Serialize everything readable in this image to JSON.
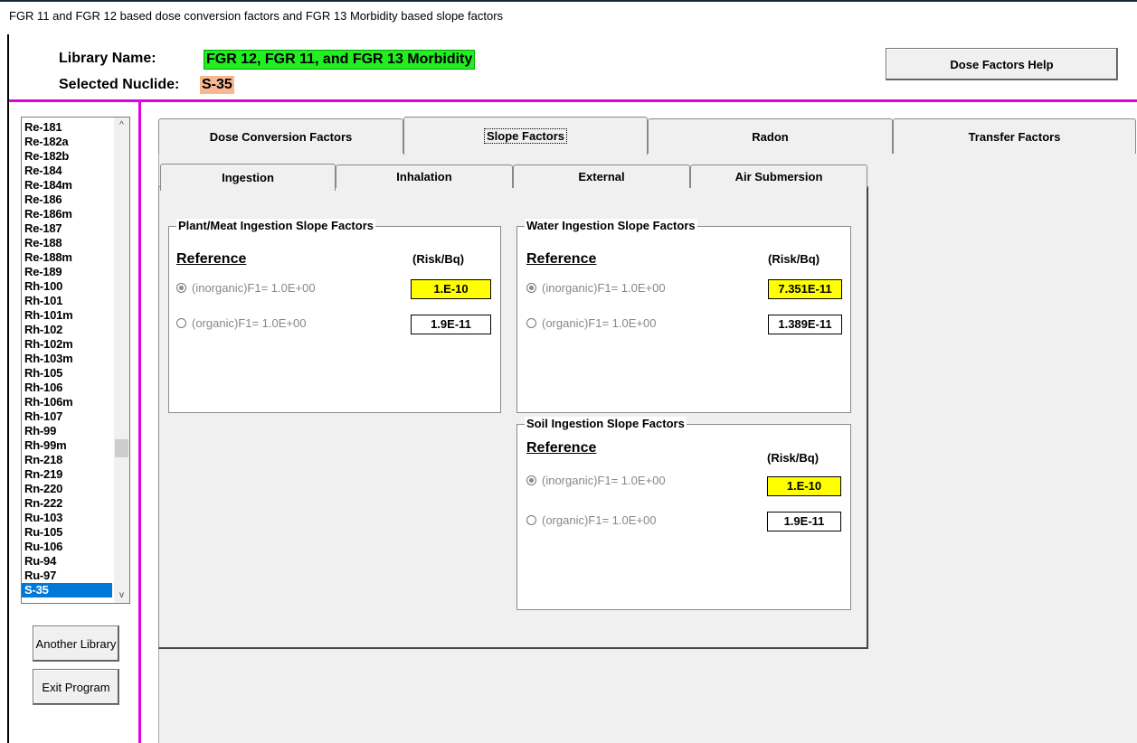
{
  "window": {
    "title": "FGR 11 and FGR 12 based dose conversion factors and FGR 13 Morbidity based slope factors"
  },
  "header": {
    "library_label": "Library Name:",
    "library_value": "FGR 12, FGR 11, and FGR 13 Morbidity",
    "nuclide_label": "Selected Nuclide:",
    "nuclide_value": "S-35",
    "help_button": "Dose Factors Help"
  },
  "nuclide_list": {
    "items": [
      "Re-181",
      "Re-182a",
      "Re-182b",
      "Re-184",
      "Re-184m",
      "Re-186",
      "Re-186m",
      "Re-187",
      "Re-188",
      "Re-188m",
      "Re-189",
      "Rh-100",
      "Rh-101",
      "Rh-101m",
      "Rh-102",
      "Rh-102m",
      "Rh-103m",
      "Rh-105",
      "Rh-106",
      "Rh-106m",
      "Rh-107",
      "Rh-99",
      "Rh-99m",
      "Rn-218",
      "Rn-219",
      "Rn-220",
      "Rn-222",
      "Ru-103",
      "Ru-105",
      "Ru-106",
      "Ru-94",
      "Ru-97",
      "S-35"
    ],
    "selected": "S-35",
    "scroll_up": "^",
    "scroll_down": "v"
  },
  "side_buttons": {
    "another_library": "Another Library",
    "exit_program": "Exit Program"
  },
  "main_tabs": {
    "dose": "Dose Conversion Factors",
    "slope": "Slope Factors",
    "radon": "Radon",
    "transfer": "Transfer Factors",
    "active": "slope"
  },
  "sub_tabs": {
    "ingestion": "Ingestion",
    "inhalation": "Inhalation",
    "external": "External",
    "air": "Air Submersion",
    "active": "ingestion"
  },
  "plant_meat": {
    "title": "Plant/Meat Ingestion Slope Factors",
    "reference": "Reference",
    "unit": "(Risk/Bq)",
    "inorganic_label": "(inorganic)F1= 1.0E+00",
    "inorganic_value": "1.E-10",
    "organic_label": "(organic)F1= 1.0E+00",
    "organic_value": "1.9E-11"
  },
  "water": {
    "title": "Water Ingestion Slope Factors",
    "reference": "Reference",
    "unit": "(Risk/Bq)",
    "inorganic_label": "(inorganic)F1= 1.0E+00",
    "inorganic_value": "7.351E-11",
    "organic_label": "(organic)F1= 1.0E+00",
    "organic_value": "1.389E-11"
  },
  "soil": {
    "title": "Soil Ingestion Slope Factors",
    "reference": "Reference",
    "unit": "(Risk/Bq)",
    "inorganic_label": "(inorganic)F1= 1.0E+00",
    "inorganic_value": "1.E-10",
    "organic_label": "(organic)F1= 1.0E+00",
    "organic_value": "1.9E-11"
  },
  "colors": {
    "library_highlight": "#22ee22",
    "nuclide_highlight": "#f7b890",
    "divider": "#e000e0",
    "value_highlight": "#ffff00",
    "selection": "#0078d7"
  }
}
